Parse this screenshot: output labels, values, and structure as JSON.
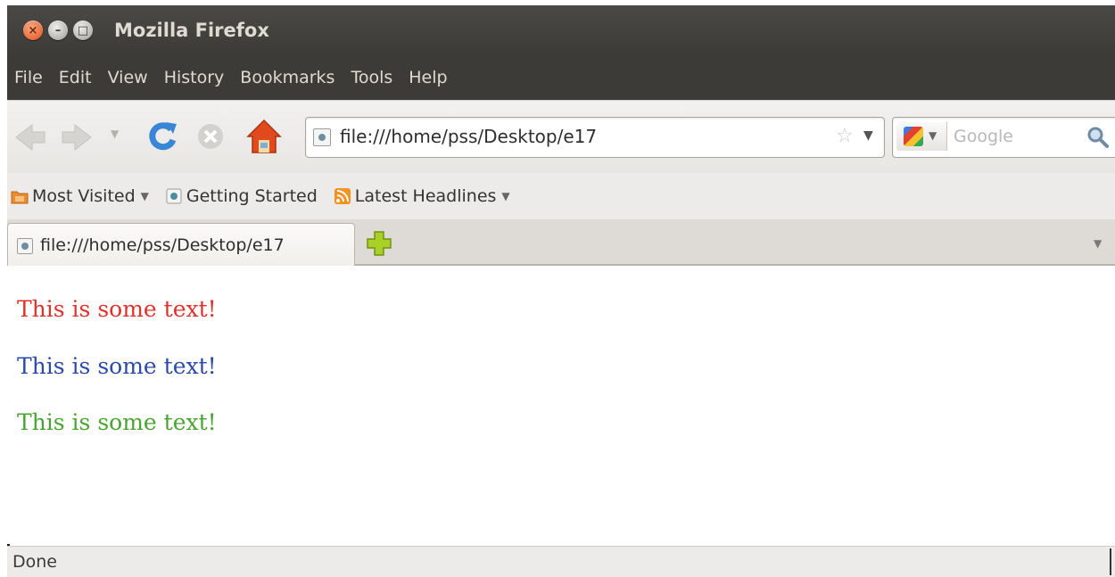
{
  "window": {
    "title": "Mozilla Firefox"
  },
  "menubar": {
    "items": [
      "File",
      "Edit",
      "View",
      "History",
      "Bookmarks",
      "Tools",
      "Help"
    ]
  },
  "navbar": {
    "url": "file:///home/pss/Desktop/e17",
    "search_placeholder": "Google"
  },
  "bookmarks": {
    "items": [
      "Most Visited",
      "Getting Started",
      "Latest Headlines"
    ]
  },
  "tabs": [
    {
      "title": "file:///home/pss/Desktop/e17"
    }
  ],
  "content": {
    "paragraphs": [
      {
        "text": "This is some text!",
        "color": "#e0312b"
      },
      {
        "text": "This is some text!",
        "color": "#2c4aa8"
      },
      {
        "text": "This is some text!",
        "color": "#48a530"
      }
    ]
  },
  "status": {
    "text": "Done"
  },
  "colors": {
    "titlebar": "#3c3b37",
    "home_icon": "#e04a1c",
    "reload_icon": "#3a86d6",
    "new_tab_plus": "#9ccc1c",
    "rss": "#f39322",
    "folder": "#e98d2f"
  }
}
